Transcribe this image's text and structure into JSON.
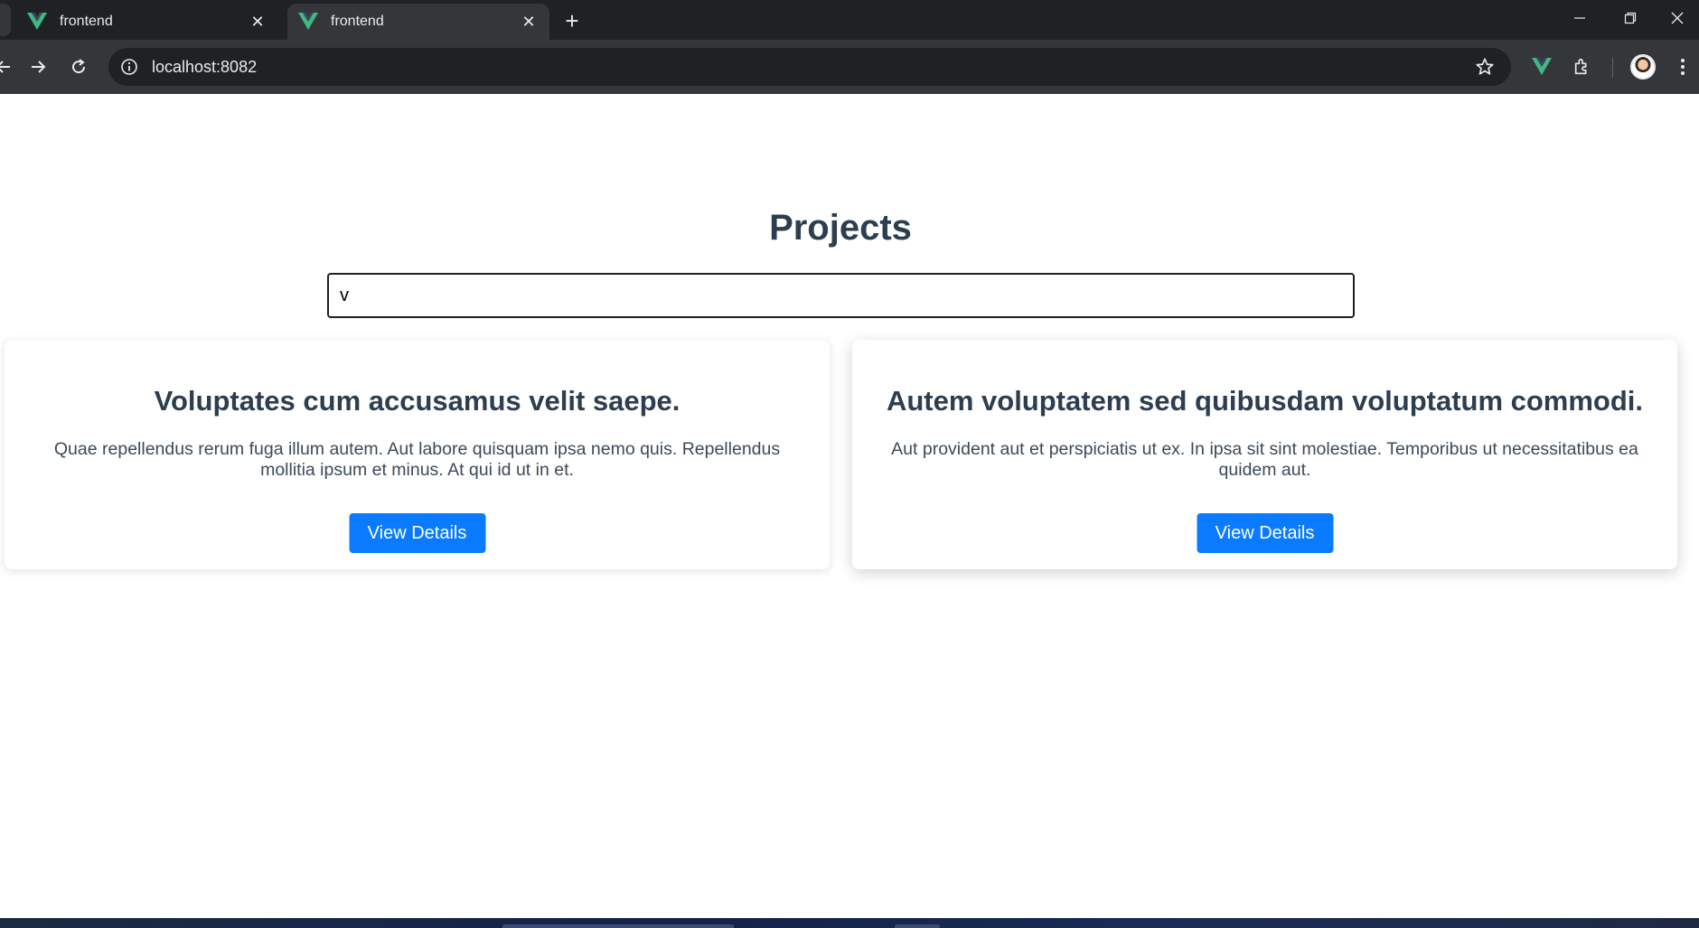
{
  "browser": {
    "tabs": [
      {
        "title": "frontend",
        "active": false
      },
      {
        "title": "frontend",
        "active": true
      }
    ],
    "url": "localhost:8082",
    "icons": {
      "tab_favicon": "vue-logo-icon",
      "close": "close-icon",
      "new_tab": "plus-icon",
      "back": "arrow-left-icon",
      "forward": "arrow-right-icon",
      "reload": "reload-icon",
      "site_info": "info-icon",
      "bookmark": "star-icon",
      "vue_devtools": "vue-devtools-icon",
      "extensions": "puzzle-icon",
      "profile": "avatar",
      "menu": "kebab-menu-icon",
      "minimize": "minimize-icon",
      "restore": "restore-icon",
      "window_close": "window-close-icon"
    },
    "colors": {
      "tabbar": "#202124",
      "toolbar": "#35363a",
      "vue_green": "#41b883"
    }
  },
  "page": {
    "title": "Projects",
    "search": {
      "value": "v",
      "placeholder": ""
    },
    "projects": [
      {
        "title": "Voluptates cum accusamus velit saepe.",
        "description": "Quae repellendus rerum fuga illum autem. Aut labore quisquam ipsa nemo quis. Repellendus mollitia ipsum et minus. At qui id ut in et.",
        "button_label": "View Details"
      },
      {
        "title": "Autem voluptatem sed quibusdam voluptatum commodi.",
        "description": "Aut provident aut et perspiciatis ut ex. In ipsa sit sint molestiae. Temporibus ut necessitatibus ea quidem aut.",
        "button_label": "View Details"
      }
    ],
    "colors": {
      "heading": "#2c3e50",
      "button": "#0a7bff"
    }
  }
}
